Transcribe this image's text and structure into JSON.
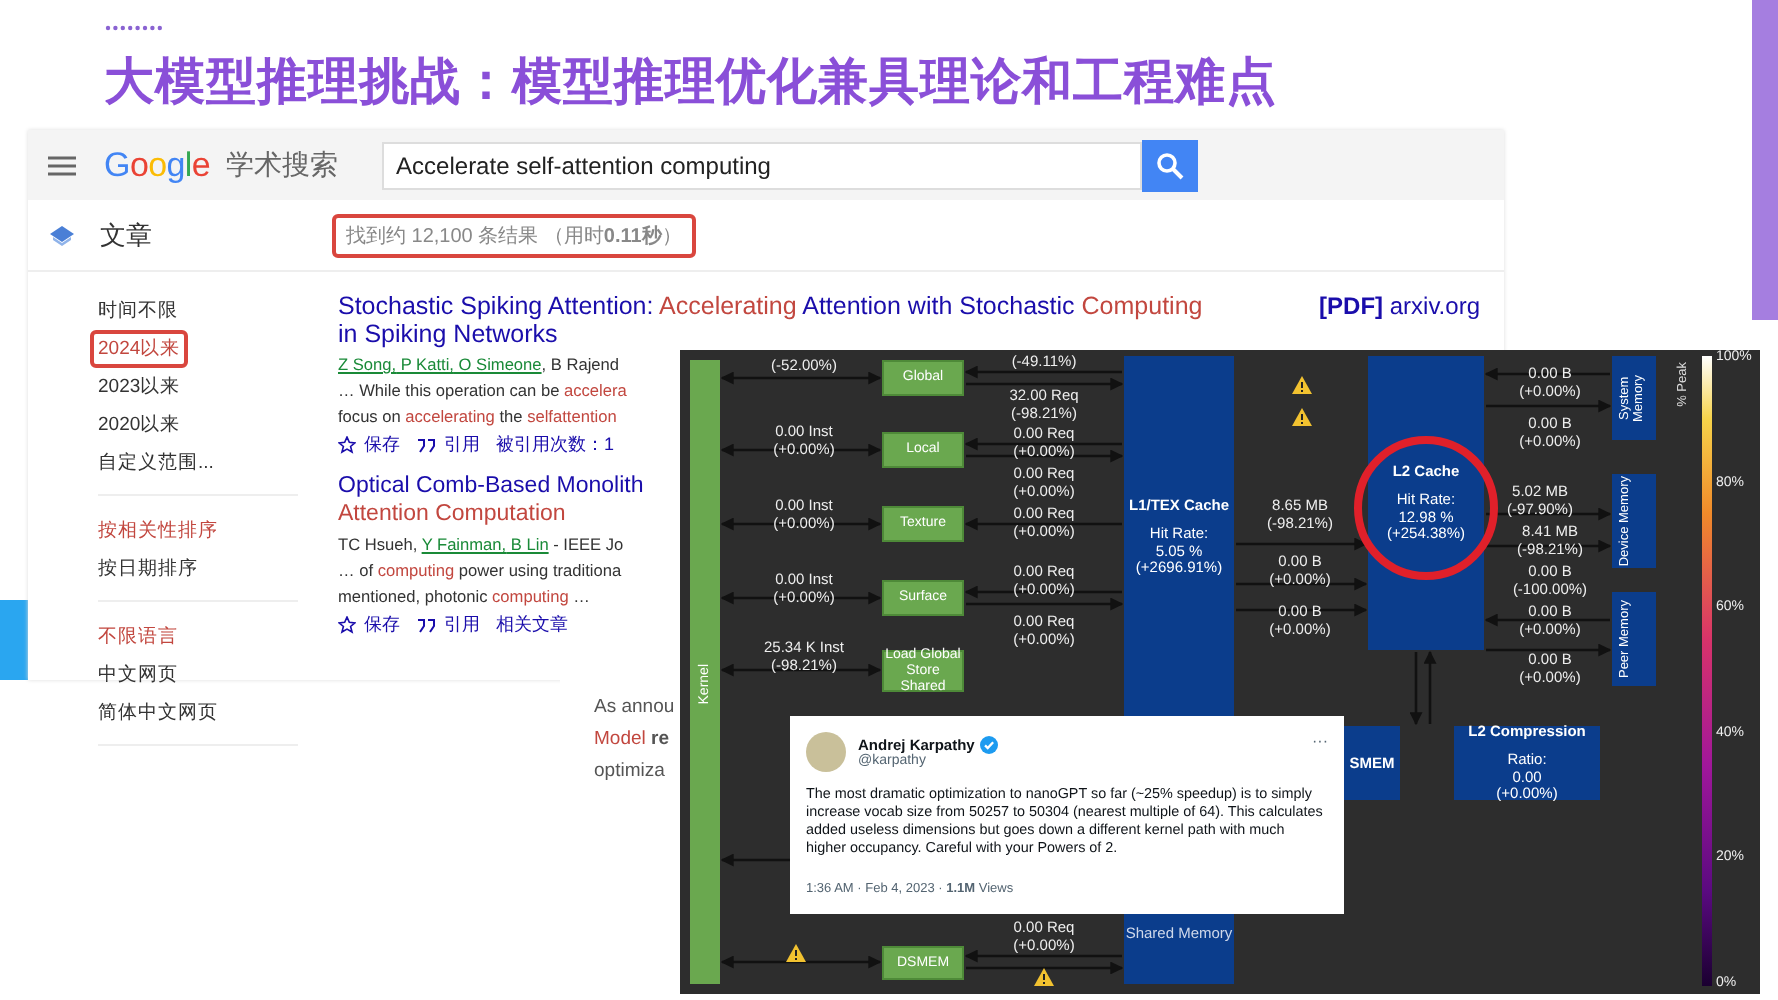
{
  "slide": {
    "title": "大模型推理挑战：模型推理优化兼具理论和工程难点"
  },
  "scholar": {
    "logo": "Google",
    "product": "学术搜索",
    "search": {
      "value": "Accelerate self-attention computing"
    },
    "section": "文章",
    "result_count": {
      "text": "找到约 12,100 条结果 （用时**0.11秒**）",
      "annotated": true
    },
    "filter_groups": [
      [
        {
          "label": "时间不限",
          "selected": false,
          "annotated": false
        },
        {
          "label": "2024以来",
          "selected": true,
          "annotated": true
        },
        {
          "label": "2023以来",
          "selected": false,
          "annotated": false
        },
        {
          "label": "2020以来",
          "selected": false,
          "annotated": false
        },
        {
          "label": "自定义范围...",
          "selected": false,
          "annotated": false
        }
      ],
      [
        {
          "label": "按相关性排序",
          "selected": true,
          "annotated": false
        },
        {
          "label": "按日期排序",
          "selected": false,
          "annotated": false
        }
      ],
      [
        {
          "label": "不限语言",
          "selected": true,
          "annotated": false
        },
        {
          "label": "中文网页",
          "selected": false,
          "annotated": false
        },
        {
          "label": "简体中文网页",
          "selected": false,
          "annotated": false
        }
      ]
    ],
    "results": [
      {
        "title": [
          {
            "kind": "text",
            "text": "Stochastic Spiking Attention: "
          },
          {
            "kind": "hit",
            "text": "Accelerating"
          },
          {
            "kind": "text",
            "text": " Attention with Stochastic "
          },
          {
            "kind": "hit",
            "text": "Computing"
          },
          {
            "kind": "text",
            "text": " in Spiking Networks"
          }
        ],
        "source": "**[PDF]** arxiv.org",
        "authors": [
          {
            "kind": "link",
            "text": "Z Song,"
          },
          {
            "kind": "link",
            "text": " P Katti,"
          },
          {
            "kind": "link",
            "text": " O Simeone"
          },
          {
            "kind": "text",
            "text": ", B Rajend"
          }
        ],
        "snippet": [
          [
            {
              "kind": "text",
              "text": "… While this operation can be "
            },
            {
              "kind": "hit",
              "text": "accelera"
            }
          ],
          [
            {
              "kind": "text",
              "text": "focus on "
            },
            {
              "kind": "hit",
              "text": "accelerating"
            },
            {
              "kind": "text",
              "text": " the "
            },
            {
              "kind": "hit",
              "text": "selfattention"
            }
          ]
        ],
        "actions": [
          {
            "kind": "save",
            "label": "保存"
          },
          {
            "kind": "cite",
            "label": "引用"
          },
          {
            "kind": "plain",
            "label": "被引用次数：1"
          }
        ]
      },
      {
        "title": [
          {
            "kind": "text",
            "text": "Optical Comb-Based Monolith"
          },
          {
            "kind": "hit",
            "text": "Attention Computation"
          }
        ],
        "authors": [
          {
            "kind": "text",
            "text": "TC Hsueh, "
          },
          {
            "kind": "link",
            "text": "Y Fainman,"
          },
          {
            "kind": "link",
            "text": " B Lin"
          },
          {
            "kind": "text",
            "text": " - IEEE Jo"
          }
        ],
        "snippet": [
          [
            {
              "kind": "text",
              "text": "… of "
            },
            {
              "kind": "hit",
              "text": "computing"
            },
            {
              "kind": "text",
              "text": " power using traditiona"
            }
          ],
          [
            {
              "kind": "text",
              "text": "mentioned, photonic "
            },
            {
              "kind": "hit",
              "text": "computing"
            },
            {
              "kind": "text",
              "text": " …"
            }
          ]
        ],
        "actions": [
          {
            "kind": "save",
            "label": "保存"
          },
          {
            "kind": "cite",
            "label": "引用"
          },
          {
            "kind": "plain",
            "label": "相关文章"
          }
        ]
      }
    ]
  },
  "article": {
    "lines": [
      [
        {
          "kind": "text",
          "text": "As annou"
        }
      ],
      [
        {
          "kind": "hit",
          "text": "Model"
        },
        {
          "kind": "bold",
          "text": " re"
        }
      ],
      [
        {
          "kind": "text",
          "text": "optimiza"
        }
      ]
    ]
  },
  "profiler": {
    "nodes": [
      {
        "kind": "kernel",
        "title": "Kernel"
      },
      {
        "kind": "unit",
        "title": "Global"
      },
      {
        "kind": "unit",
        "title": "Local"
      },
      {
        "kind": "unit",
        "title": "Texture"
      },
      {
        "kind": "unit",
        "title": "Surface"
      },
      {
        "kind": "unit",
        "title": "Load Global Store Shared"
      },
      {
        "kind": "unit",
        "title": "DSMEM"
      },
      {
        "kind": "cache",
        "title": "L1/TEX Cache",
        "lines": [
          "Hit Rate:",
          "5.05 %",
          "(+2696.91%)"
        ],
        "footer": "Shared Memory"
      },
      {
        "kind": "cache",
        "title": "L2 Cache",
        "lines": [
          "Hit Rate:",
          "12.98 %",
          "(+254.38%)"
        ],
        "circled": true
      },
      {
        "kind": "memory",
        "title": "System Memory"
      },
      {
        "kind": "memory",
        "title": "Device Memory"
      },
      {
        "kind": "memory",
        "title": "Peer Memory"
      },
      {
        "kind": "cache",
        "title": "SMEM"
      },
      {
        "kind": "cache",
        "title": "L2 Compression",
        "lines": [
          "Ratio:",
          "0.00",
          "(+0.00%)"
        ]
      }
    ],
    "labels": [
      [
        "(-52.00%)"
      ],
      [
        "0.00 Inst",
        "(+0.00%)"
      ],
      [
        "0.00 Inst",
        "(+0.00%)"
      ],
      [
        "0.00 Inst",
        "(+0.00%)"
      ],
      [
        "25.34 K Inst",
        "(-98.21%)"
      ],
      [
        "(-49.11%)"
      ],
      [
        "32.00 Req",
        "(-98.21%)"
      ],
      [
        "0.00 Req",
        "(+0.00%)"
      ],
      [
        "0.00 Req",
        "(+0.00%)"
      ],
      [
        "0.00 Req",
        "(+0.00%)"
      ],
      [
        "0.00 Req",
        "(+0.00%)"
      ],
      [
        "0.00 Req",
        "(+0.00%)"
      ],
      [
        "0.00 Req",
        "(+0.00%)"
      ],
      [
        "8.65 MB",
        "(-98.21%)"
      ],
      [
        "0.00 B",
        "(+0.00%)"
      ],
      [
        "0.00 B",
        "(+0.00%)"
      ],
      [
        "0.00 B",
        "(+0.00%)"
      ],
      [
        "0.00 B",
        "(+0.00%)"
      ],
      [
        "5.02 MB",
        "(-97.90%)"
      ],
      [
        "8.41 MB",
        "(-98.21%)"
      ],
      [
        "0.00 B",
        "(-100.00%)"
      ],
      [
        "0.00 B",
        "(+0.00%)"
      ],
      [
        "0.00 B",
        "(+0.00%)"
      ]
    ],
    "scale": {
      "title": "% Peak",
      "ticks": [
        "100%",
        "80%",
        "60%",
        "40%",
        "20%",
        "0%"
      ]
    }
  },
  "tweet": {
    "name": "Andrej Karpathy",
    "verified": true,
    "handle": "@karpathy",
    "more": "···",
    "text": "The most dramatic optimization to nanoGPT so far (~25% speedup) is to simply increase vocab size from 50257 to 50304 (nearest multiple of 64). This calculates added useless dimensions but goes down a different kernel path with much higher occupancy. Careful with your Powers of 2.",
    "meta": "1:36 AM · Feb 4, 2023 · **1.1M** Views"
  }
}
